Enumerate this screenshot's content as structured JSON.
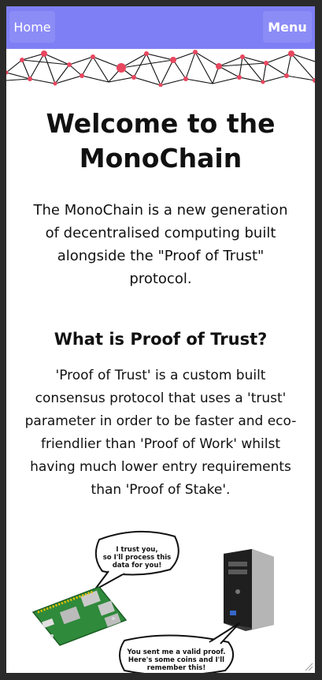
{
  "nav": {
    "home_label": "Home",
    "menu_label": "Menu"
  },
  "colors": {
    "navbar": "#7f7ff5",
    "node": "#e8475f"
  },
  "hero": {
    "title": "Welcome to the MonoChain",
    "intro": "The MonoChain is a new generation of decentralised computing built alongside the \"Proof of Trust\" protocol."
  },
  "section": {
    "heading": "What is Proof of Trust?",
    "body": "'Proof of Trust' is a custom built consensus protocol that uses a 'trust' parameter in order to be faster and eco-friendlier than 'Proof of Work' whilst having much lower entry requirements than 'Proof of Stake'."
  },
  "illustration": {
    "bubble_top": [
      "I trust you,",
      "so I'll process this",
      "data for you!"
    ],
    "bubble_bottom": [
      "You sent me a valid proof.",
      "Here's some coins and I'll",
      "remember this!"
    ]
  }
}
